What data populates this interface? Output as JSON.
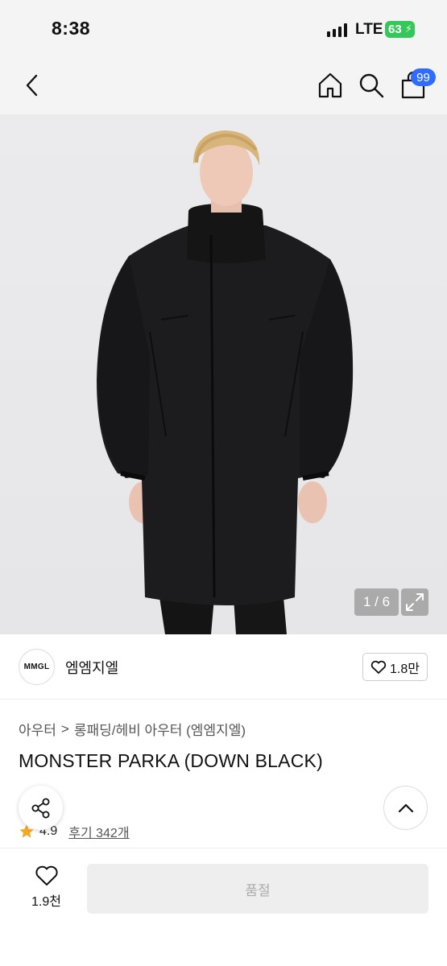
{
  "status": {
    "time": "8:38",
    "network": "LTE",
    "battery": "63"
  },
  "nav": {
    "cart_count": "99"
  },
  "gallery": {
    "pager": "1 / 6"
  },
  "brand": {
    "logo_text": "MMGL",
    "name": "엠엠지엘",
    "like_count": "1.8만"
  },
  "breadcrumb": {
    "category": "아우터",
    "separator": ">",
    "subcategory": "롱패딩/헤비 아우터 (엠엠지엘)"
  },
  "product": {
    "title": "MONSTER PARKA (DOWN BLACK)",
    "rating": "4.9",
    "reviews": "후기 342개"
  },
  "bottom": {
    "wish_count": "1.9천",
    "soldout_label": "품절"
  },
  "colors": {
    "accent": "#2f6bff",
    "battery": "#34c759",
    "star": "#f5a623"
  }
}
